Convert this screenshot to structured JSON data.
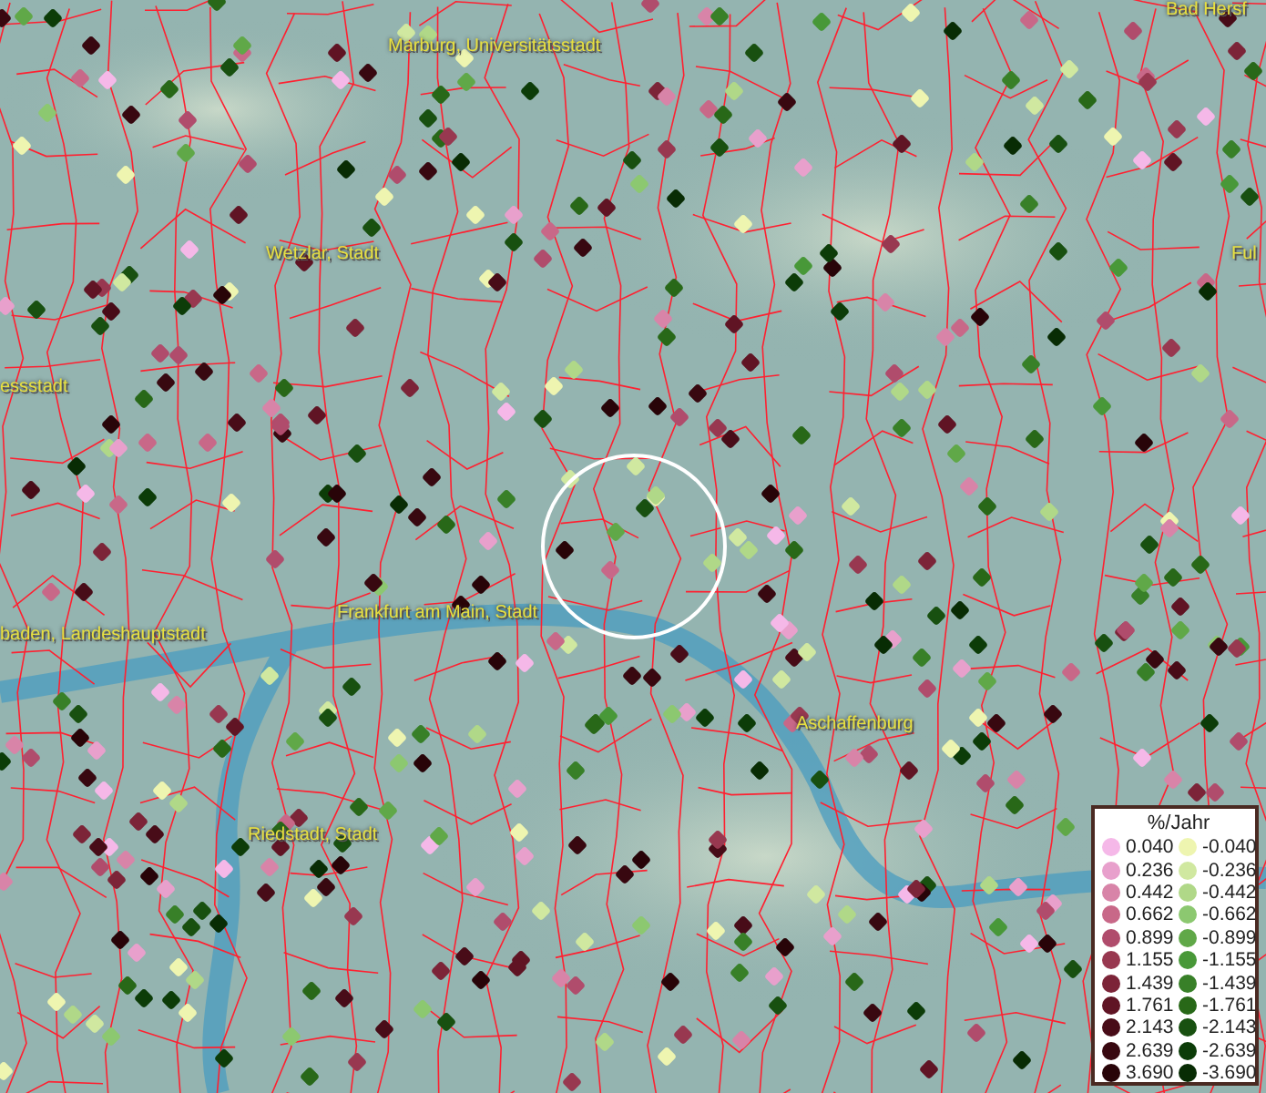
{
  "map": {
    "place_labels": [
      "Bad Hersf",
      "Marburg, Universitätsstadt",
      "Wetzlar, Stadt",
      "Ful",
      "essstadt",
      "baden, Landeshauptstadt",
      "Frankfurt am Main, Stadt",
      "Aschaffenburg",
      "Riedstadt, Stadt"
    ]
  },
  "legend": {
    "title": "%/Jahr",
    "entries": [
      {
        "label": "0.040",
        "color": "#f5b8e8"
      },
      {
        "label": "-0.040",
        "color": "#eef5b0"
      },
      {
        "label": "0.236",
        "color": "#e8a0cc"
      },
      {
        "label": "-0.236",
        "color": "#d0e8a0"
      },
      {
        "label": "0.442",
        "color": "#d884a8"
      },
      {
        "label": "-0.442",
        "color": "#b0d888"
      },
      {
        "label": "0.662",
        "color": "#c86888"
      },
      {
        "label": "-0.662",
        "color": "#8cc870"
      },
      {
        "label": "0.899",
        "color": "#b04c6c"
      },
      {
        "label": "-0.899",
        "color": "#60a848"
      },
      {
        "label": "1.155",
        "color": "#983850"
      },
      {
        "label": "-1.155",
        "color": "#489838"
      },
      {
        "label": "1.439",
        "color": "#7c2438"
      },
      {
        "label": "-1.439",
        "color": "#388028"
      },
      {
        "label": "1.761",
        "color": "#601424"
      },
      {
        "label": "-1.761",
        "color": "#286818"
      },
      {
        "label": "2.143",
        "color": "#480c18"
      },
      {
        "label": "-2.143",
        "color": "#185010"
      },
      {
        "label": "2.639",
        "color": "#380810"
      },
      {
        "label": "-2.639",
        "color": "#0c3c08"
      },
      {
        "label": "3.690",
        "color": "#280408"
      },
      {
        "label": "-3.690",
        "color": "#082c04"
      }
    ]
  }
}
